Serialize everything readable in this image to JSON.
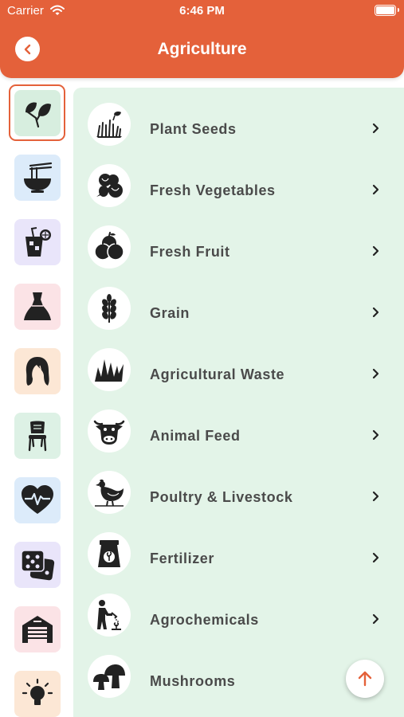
{
  "status_bar": {
    "carrier": "Carrier",
    "time": "6:46 PM"
  },
  "header": {
    "title": "Agriculture"
  },
  "sidebar": {
    "categories": [
      {
        "icon": "leaf-icon",
        "selected": true,
        "tile_color": "#D7EEDF"
      },
      {
        "icon": "noodle-bowl-icon",
        "selected": false,
        "tile_color": "#DCEBFA"
      },
      {
        "icon": "drink-icon",
        "selected": false,
        "tile_color": "#E9E5FA"
      },
      {
        "icon": "dress-icon",
        "selected": false,
        "tile_color": "#FBE3E6"
      },
      {
        "icon": "hair-icon",
        "selected": false,
        "tile_color": "#FCE7D5"
      },
      {
        "icon": "chair-icon",
        "selected": false,
        "tile_color": "#DDF1E5"
      },
      {
        "icon": "heart-pulse-icon",
        "selected": false,
        "tile_color": "#DCEBFA"
      },
      {
        "icon": "pillows-icon",
        "selected": false,
        "tile_color": "#E9E5FA"
      },
      {
        "icon": "warehouse-icon",
        "selected": false,
        "tile_color": "#FBE3E6"
      },
      {
        "icon": "lightbulb-icon",
        "selected": false,
        "tile_color": "#FCE7D5"
      }
    ]
  },
  "main": {
    "items": [
      {
        "label": "Plant Seeds",
        "icon": "seedling-icon"
      },
      {
        "label": "Fresh Vegetables",
        "icon": "vegetables-icon"
      },
      {
        "label": "Fresh Fruit",
        "icon": "fruit-icon"
      },
      {
        "label": "Grain",
        "icon": "wheat-icon"
      },
      {
        "label": "Agricultural Waste",
        "icon": "grass-icon"
      },
      {
        "label": "Animal Feed",
        "icon": "cow-icon"
      },
      {
        "label": "Poultry & Livestock",
        "icon": "chicken-icon"
      },
      {
        "label": "Fertilizer",
        "icon": "fertilizer-bag-icon"
      },
      {
        "label": "Agrochemicals",
        "icon": "gardener-icon"
      },
      {
        "label": "Mushrooms",
        "icon": "mushroom-icon"
      }
    ]
  },
  "colors": {
    "accent": "#E4613A",
    "list_background": "#E3F4E8"
  }
}
